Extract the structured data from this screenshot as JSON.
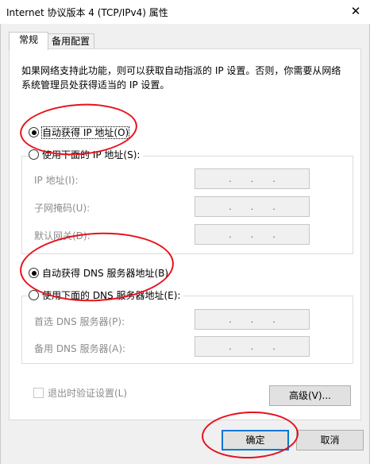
{
  "window": {
    "title": "Internet 协议版本 4 (TCP/IPv4) 属性",
    "close_glyph": "✕"
  },
  "tabs": [
    {
      "label": "常规"
    },
    {
      "label": "备用配置"
    }
  ],
  "description": "如果网络支持此功能，则可以获取自动指派的 IP 设置。否则，你需要从网络系统管理员处获得适当的 IP 设置。",
  "ip": {
    "auto_label": "自动获得 IP 地址(O)",
    "manual_label": "使用下面的 IP 地址(S):",
    "selected": "auto",
    "fields": [
      {
        "label": "IP 地址(I):",
        "value": ".   .   ."
      },
      {
        "label": "子网掩码(U):",
        "value": ".   .   ."
      },
      {
        "label": "默认网关(D):",
        "value": ".   .   ."
      }
    ]
  },
  "dns": {
    "auto_label": "自动获得 DNS 服务器地址(B)",
    "manual_label": "使用下面的 DNS 服务器地址(E):",
    "selected": "auto",
    "fields": [
      {
        "label": "首选 DNS 服务器(P):",
        "value": ".   .   ."
      },
      {
        "label": "备用 DNS 服务器(A):",
        "value": ".   .   ."
      }
    ]
  },
  "validate_label": "退出时验证设置(L)",
  "validate_checked": false,
  "advanced_label": "高级(V)...",
  "ok_label": "确定",
  "cancel_label": "取消",
  "annotation_color": "#e8111a"
}
